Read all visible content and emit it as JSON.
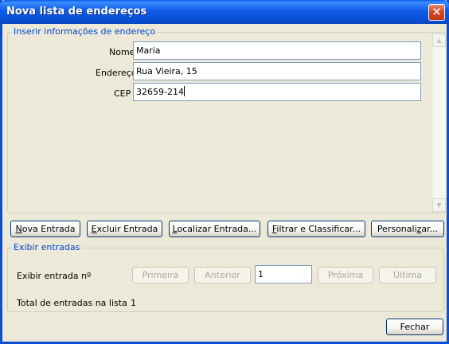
{
  "window": {
    "title": "Nova lista de endereços",
    "close_glyph": "✕"
  },
  "input_group": {
    "legend": "Inserir informações de endereço",
    "fields": [
      {
        "label": "Nome",
        "value": "Maria"
      },
      {
        "label": "Endereço",
        "value": "Rua Vieira, 15"
      },
      {
        "label": "CEP",
        "value": "32659-214"
      }
    ]
  },
  "scrollbar": {
    "up_icon": "▲",
    "down_icon": "▼"
  },
  "toolbar": {
    "new_entry": {
      "pre": "",
      "mn": "N",
      "post": "ova Entrada"
    },
    "delete_entry": {
      "pre": "",
      "mn": "E",
      "post": "xcluir Entrada"
    },
    "find_entry": {
      "pre": "",
      "mn": "L",
      "post": "ocalizar Entrada..."
    },
    "filter_sort": {
      "pre": "",
      "mn": "F",
      "post": "iltrar e Classificar..."
    },
    "customize": {
      "pre": "Personali",
      "mn": "z",
      "post": "ar..."
    }
  },
  "view_group": {
    "legend": "Exibir entradas",
    "show_entry_label": "Exibir entrada nº",
    "first": "Primeira",
    "previous": "Anterior",
    "entry_number": "1",
    "next": "Próxima",
    "last": "Última",
    "total_label": "Total de entradas na lista",
    "total_value": "1"
  },
  "close_button": "Fechar"
}
